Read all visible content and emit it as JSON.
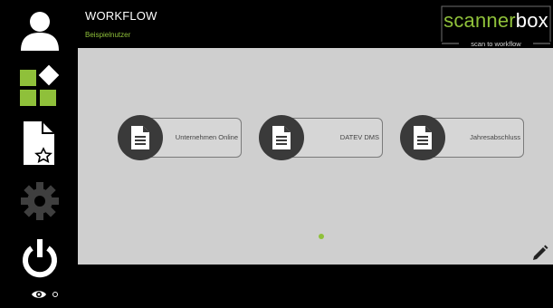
{
  "header": {
    "title": "WORKFLOW",
    "user": "Beispielnutzer"
  },
  "logo": {
    "brand_part1": "scanner",
    "brand_part2": "box",
    "tagline": "scan to workflow"
  },
  "sidebar": {
    "items": [
      {
        "icon": "user-icon"
      },
      {
        "icon": "apps-icon"
      },
      {
        "icon": "favorite-document-icon"
      },
      {
        "icon": "gear-icon"
      },
      {
        "icon": "power-icon"
      }
    ],
    "footer_icon": "eye-icon"
  },
  "workflows": [
    {
      "label": "Unternehmen Online",
      "icon": "document-icon"
    },
    {
      "label": "DATEV DMS",
      "icon": "document-icon"
    },
    {
      "label": "Jahresabschluss",
      "icon": "document-icon"
    }
  ],
  "pagination": {
    "current": 1,
    "total": 1
  },
  "colors": {
    "accent": "#8fc03a",
    "panel": "#cfcfcf",
    "sidebar": "#000000",
    "tile_circle": "#3a3a3a"
  }
}
